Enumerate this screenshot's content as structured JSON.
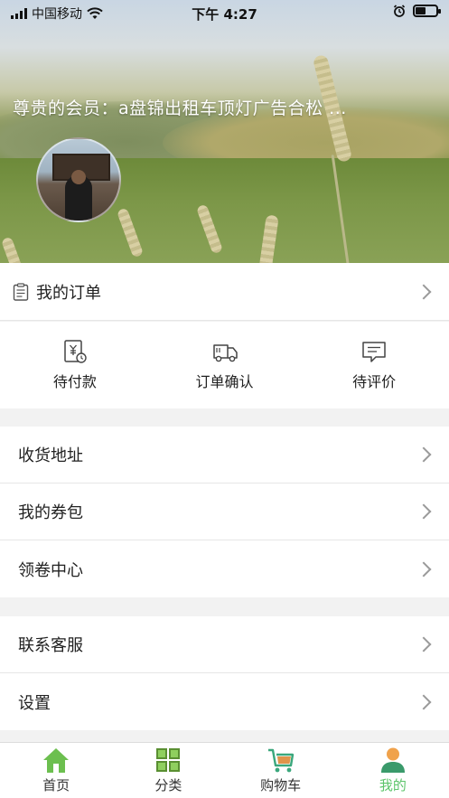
{
  "status_bar": {
    "carrier": "中国移动",
    "time": "下午 4:27",
    "battery_level": 0.5
  },
  "header": {
    "member_text": "尊贵的会员：a盘锦出租车顶灯广告合松 ..."
  },
  "my_orders": {
    "label": "我的订单"
  },
  "order_status": [
    {
      "label": "待付款",
      "icon": "payment-pending-icon"
    },
    {
      "label": "订单确认",
      "icon": "truck-icon"
    },
    {
      "label": "待评价",
      "icon": "review-icon"
    }
  ],
  "menu_group_1": [
    {
      "label": "收货地址"
    },
    {
      "label": "我的券包"
    },
    {
      "label": "领卷中心"
    }
  ],
  "menu_group_2": [
    {
      "label": "联系客服"
    },
    {
      "label": "设置"
    }
  ],
  "tabbar": [
    {
      "label": "首页",
      "icon": "home-icon"
    },
    {
      "label": "分类",
      "icon": "category-icon"
    },
    {
      "label": "购物车",
      "icon": "cart-icon"
    },
    {
      "label": "我的",
      "icon": "profile-icon",
      "active": true
    }
  ],
  "colors": {
    "accent": "#5cc46a",
    "home_icon": "#6cbf4f",
    "category_icon": "#5a8f32",
    "cart_icon": "#3aa77c",
    "profile_icon_head": "#f0a24b"
  }
}
